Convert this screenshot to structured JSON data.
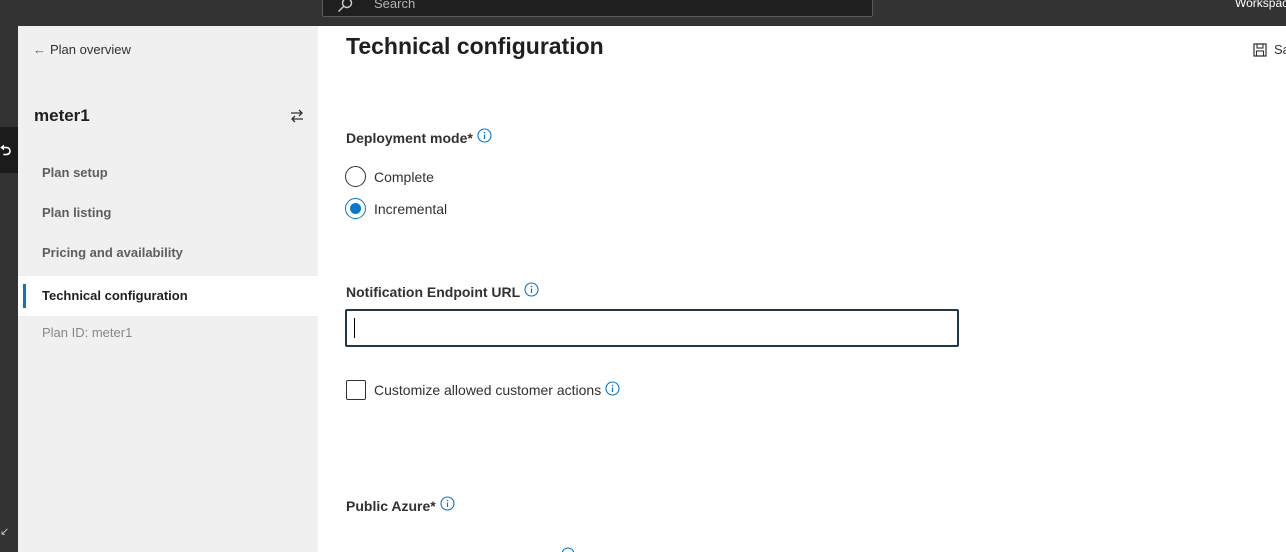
{
  "topbar": {
    "search_placeholder": "Search",
    "workspace_label": "Workspaces",
    "background": "#333333"
  },
  "sidenav": {
    "back_label": "Plan overview",
    "plan_name": "meter1",
    "items": [
      {
        "label": "Plan setup",
        "active": false
      },
      {
        "label": "Plan listing",
        "active": false
      },
      {
        "label": "Pricing and availability",
        "active": false
      },
      {
        "label": "Technical configuration",
        "active": true
      }
    ],
    "plan_id": "Plan ID: meter1"
  },
  "main": {
    "title": "Technical configuration",
    "save_label": "Save",
    "deployment_mode": {
      "label": "Deployment mode*",
      "options": [
        {
          "label": "Complete",
          "selected": false
        },
        {
          "label": "Incremental",
          "selected": true
        }
      ]
    },
    "notification_endpoint": {
      "label": "Notification Endpoint URL",
      "value": ""
    },
    "customize_actions": {
      "label": "Customize allowed customer actions",
      "checked": false
    },
    "public_azure": {
      "label": "Public Azure*"
    }
  },
  "colors": {
    "accent": "#0078d4",
    "nav_background": "#f0f0f0",
    "input_border": "#1d3a4d"
  }
}
